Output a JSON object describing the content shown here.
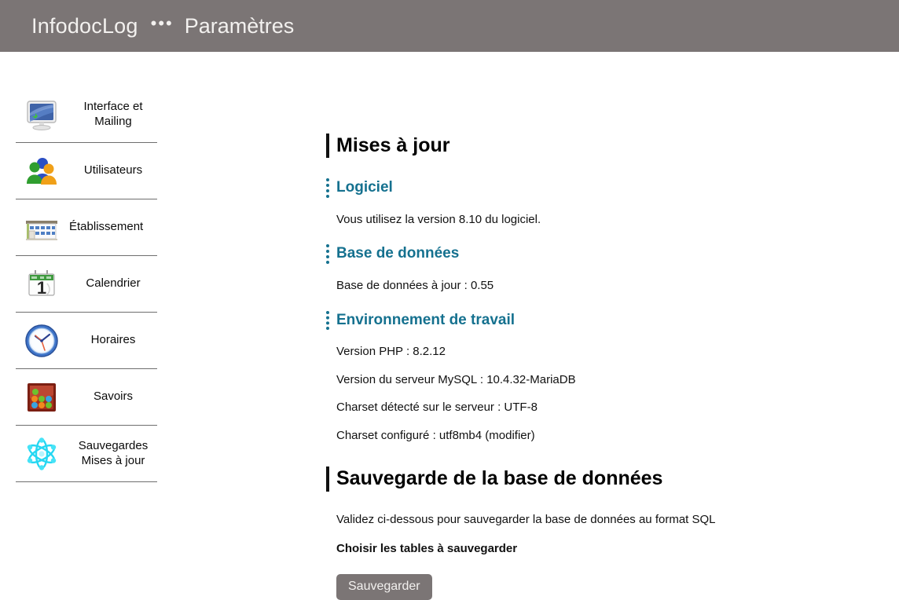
{
  "header": {
    "brand": "InfodocLog",
    "separator": "•••",
    "page_title": "Paramètres",
    "background_color": "#7b7575",
    "text_color": "#f3f1ef"
  },
  "sidebar": {
    "items": [
      {
        "label": "Interface et Mailing",
        "icon": "monitor-icon",
        "multiline": true
      },
      {
        "label": "Utilisateurs",
        "icon": "users-icon",
        "multiline": false
      },
      {
        "label": "Établissement",
        "icon": "building-icon",
        "multiline": false
      },
      {
        "label": "Calendrier",
        "icon": "calendar-icon",
        "multiline": false
      },
      {
        "label": "Horaires",
        "icon": "clock-icon",
        "multiline": false
      },
      {
        "label": "Savoirs",
        "icon": "knowledge-blocks-icon",
        "multiline": false
      },
      {
        "label": "Sauvegardes Mises à jour",
        "icon": "atom-icon",
        "multiline": true
      }
    ]
  },
  "main": {
    "updates": {
      "title": "Mises à jour",
      "software": {
        "heading": "Logiciel",
        "text": "Vous utilisez la version 8.10 du logiciel."
      },
      "database": {
        "heading": "Base de données",
        "text": "Base de données à jour : 0.55"
      },
      "environment": {
        "heading": "Environnement de travail",
        "php": "Version PHP : 8.2.12",
        "mysql": "Version du serveur MySQL : 10.4.32-MariaDB",
        "charset_detected": "Charset détecté sur le serveur : UTF-8",
        "charset_configured": "Charset configuré : utf8mb4 (modifier)"
      }
    },
    "backup": {
      "title": "Sauvegarde de la base de données",
      "intro": "Validez ci-dessous pour sauvegarder la base de données au format SQL",
      "choose_tables_label": "Choisir les tables à sauvegarder",
      "save_button": "Sauvegarder"
    }
  },
  "theme": {
    "accent_teal": "#15718f",
    "grey": "#7b7575"
  }
}
